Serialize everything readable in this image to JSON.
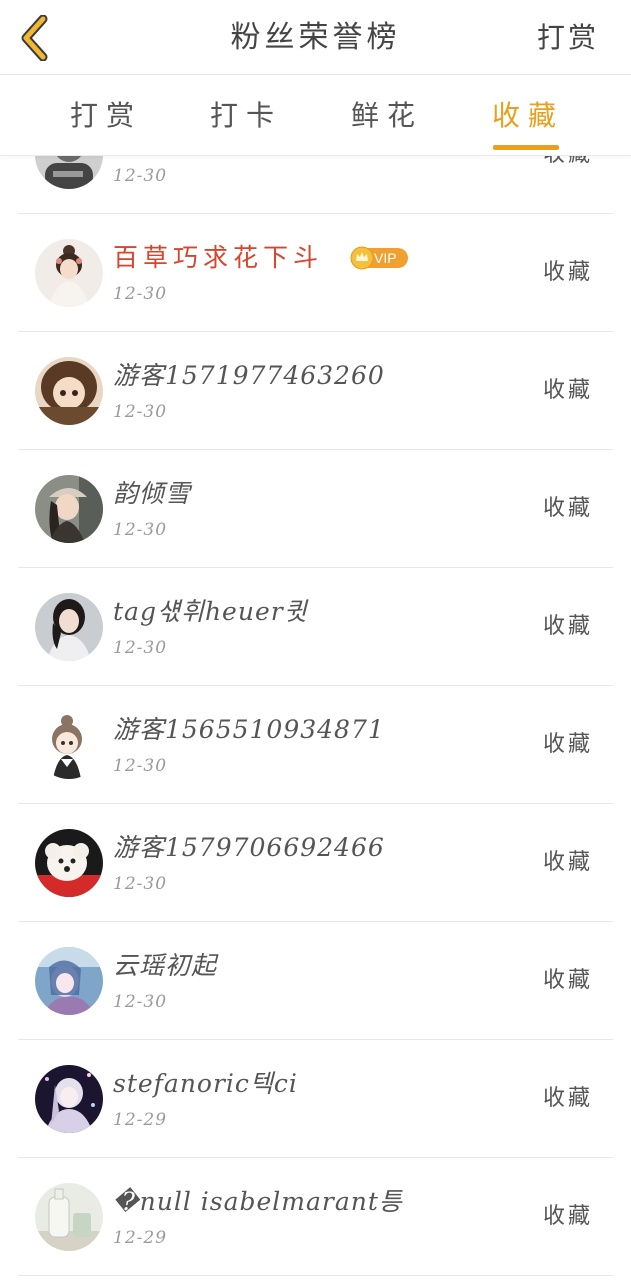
{
  "header": {
    "title": "粉丝荣誉榜",
    "action": "打赏"
  },
  "tabs": [
    {
      "label": "打赏",
      "active": false
    },
    {
      "label": "打卡",
      "active": false
    },
    {
      "label": "鲜花",
      "active": false
    },
    {
      "label": "收藏",
      "active": true
    }
  ],
  "colors": {
    "accent": "#e8a01e",
    "vip_name": "#d9442c",
    "vip_badge": "#f0a030"
  },
  "fans": [
    {
      "name": "",
      "date": "12-30",
      "action": "收藏",
      "avatar": "grey-portrait-avatar",
      "vip": false
    },
    {
      "name": "百草巧求花下斗",
      "date": "12-30",
      "action": "收藏",
      "avatar": "costume-girl-avatar",
      "vip": true,
      "vip_label": "VIP"
    },
    {
      "name": "游客1571977463260",
      "date": "12-30",
      "action": "收藏",
      "avatar": "cartoon-girl-avatar",
      "vip": false
    },
    {
      "name": "韵倾雪",
      "date": "12-30",
      "action": "收藏",
      "avatar": "capped-girl-avatar",
      "vip": false
    },
    {
      "name": "tag섃휘heuer큇",
      "date": "12-30",
      "action": "收藏",
      "avatar": "girl-photo-avatar",
      "vip": false
    },
    {
      "name": "游客1565510934871",
      "date": "12-30",
      "action": "收藏",
      "avatar": "chibi-girl-avatar",
      "vip": false
    },
    {
      "name": "游客1579706692466",
      "date": "12-30",
      "action": "收藏",
      "avatar": "puppy-avatar",
      "vip": false
    },
    {
      "name": "云瑶初起",
      "date": "12-30",
      "action": "收藏",
      "avatar": "anime-blue-avatar",
      "vip": false
    },
    {
      "name": "stefanoric텍ci",
      "date": "12-29",
      "action": "收藏",
      "avatar": "anime-dark-avatar",
      "vip": false
    },
    {
      "name": "�null isabelmarant틍",
      "date": "12-29",
      "action": "收藏",
      "avatar": "bottle-avatar",
      "vip": false
    }
  ]
}
